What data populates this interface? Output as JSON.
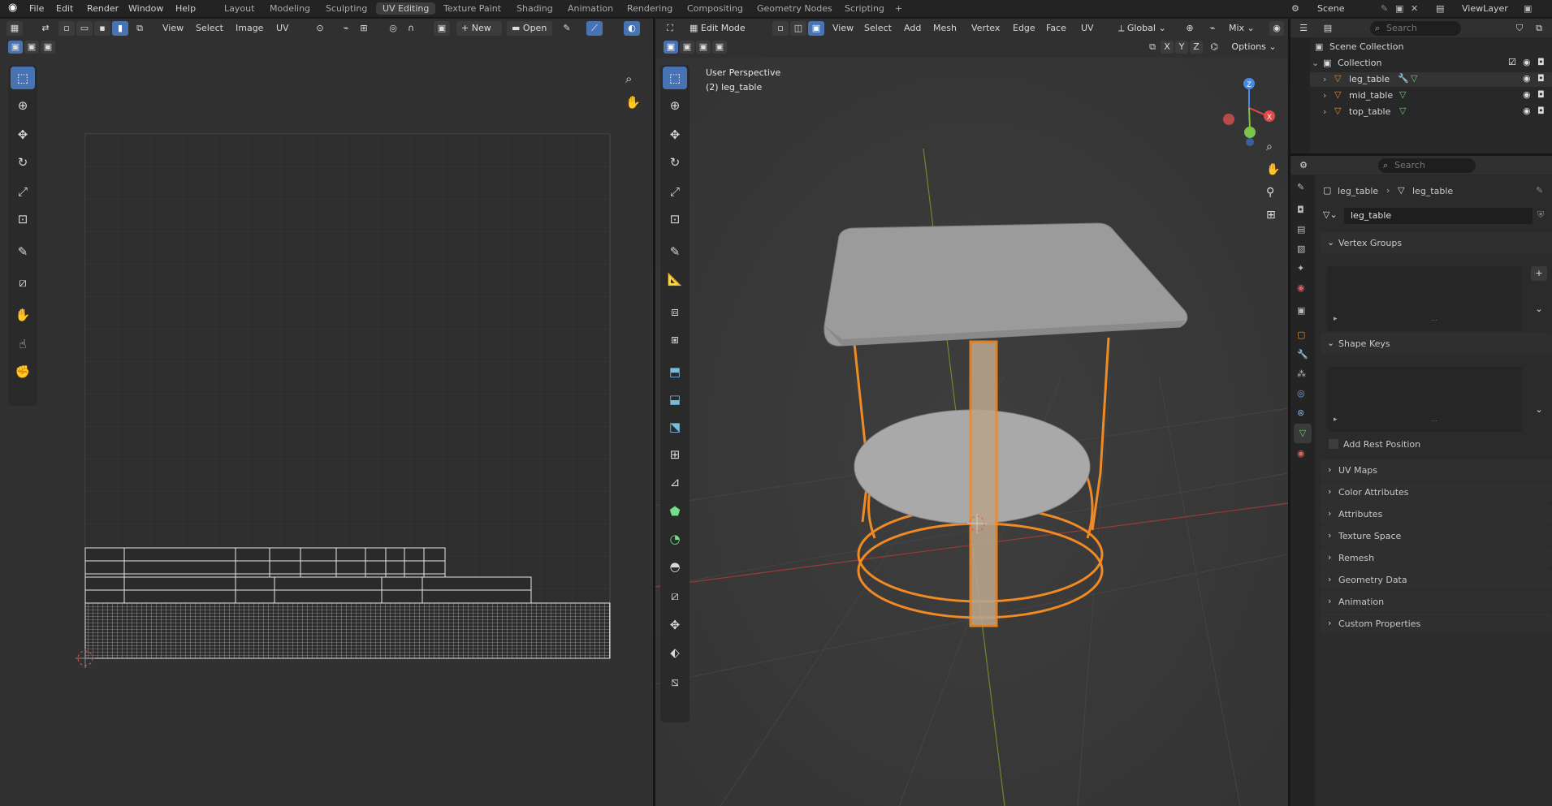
{
  "topbar": {
    "menus": [
      "File",
      "Edit",
      "Render",
      "Window",
      "Help"
    ],
    "workspaces": [
      "Layout",
      "Modeling",
      "Sculpting",
      "UV Editing",
      "Texture Paint",
      "Shading",
      "Animation",
      "Rendering",
      "Compositing",
      "Geometry Nodes",
      "Scripting"
    ],
    "active_workspace": "UV Editing",
    "add_tab": "+",
    "scene_label": "Scene",
    "viewlayer_label": "ViewLayer"
  },
  "uv_editor": {
    "menus": [
      "View",
      "Select",
      "Image",
      "UV"
    ],
    "new_label": "New",
    "open_label": "Open"
  },
  "viewport": {
    "mode": "Edit Mode",
    "menus": [
      "View",
      "Select",
      "Add",
      "Mesh",
      "Vertex",
      "Edge",
      "Face",
      "UV"
    ],
    "transform_orientation": "Global",
    "shading_mix": "Mix",
    "options_label": "Options",
    "axis_buttons": [
      "X",
      "Y",
      "Z"
    ],
    "overlay_title": "User Perspective",
    "overlay_object": "(2) leg_table",
    "gizmo_axes": [
      "X",
      "Y",
      "Z"
    ]
  },
  "outliner": {
    "search_placeholder": "Search",
    "scene_collection": "Scene Collection",
    "collection": "Collection",
    "objects": [
      "leg_table",
      "mid_table",
      "top_table"
    ]
  },
  "properties": {
    "search_placeholder": "Search",
    "breadcrumb_object": "leg_table",
    "breadcrumb_mesh": "leg_table",
    "mesh_name": "leg_table",
    "panels_open": [
      "Vertex Groups",
      "Shape Keys"
    ],
    "add_rest_position": "Add Rest Position",
    "panels_closed": [
      "UV Maps",
      "Color Attributes",
      "Attributes",
      "Texture Space",
      "Remesh",
      "Geometry Data",
      "Animation",
      "Custom Properties"
    ]
  },
  "colors": {
    "accent_blue": "#4772b3",
    "selection_orange": "#f08a24",
    "axis_x": "#e04a4a",
    "axis_y": "#7cc34a",
    "axis_z": "#4a8ae0"
  }
}
